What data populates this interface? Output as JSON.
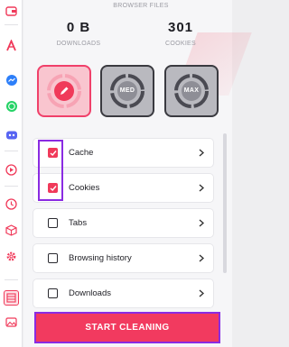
{
  "header": {
    "section_caption": "BROWSER FILES",
    "downloads_value": "0 B",
    "downloads_label": "DOWNLOADS",
    "cookies_value": "301",
    "cookies_label": "COOKIES"
  },
  "modes": {
    "items": [
      {
        "icon": "pencil-icon",
        "label": "",
        "active": true
      },
      {
        "icon": "",
        "label": "MED",
        "active": false
      },
      {
        "icon": "",
        "label": "MAX",
        "active": false
      }
    ]
  },
  "options": {
    "items": [
      {
        "label": "Cache",
        "checked": true
      },
      {
        "label": "Cookies",
        "checked": true
      },
      {
        "label": "Tabs",
        "checked": false
      },
      {
        "label": "Browsing history",
        "checked": false
      },
      {
        "label": "Downloads",
        "checked": false
      }
    ]
  },
  "actions": {
    "start_label": "START CLEANING"
  },
  "sidebar": {
    "icons": [
      "aria-icon",
      "messenger-icon",
      "whatsapp-icon",
      "discord-icon",
      "player-icon",
      "history-icon",
      "cube-icon",
      "settings-icon",
      "browser-files-icon",
      "gallery-icon"
    ]
  },
  "colors": {
    "accent": "#f23a5f",
    "highlight": "#8a2be2"
  }
}
